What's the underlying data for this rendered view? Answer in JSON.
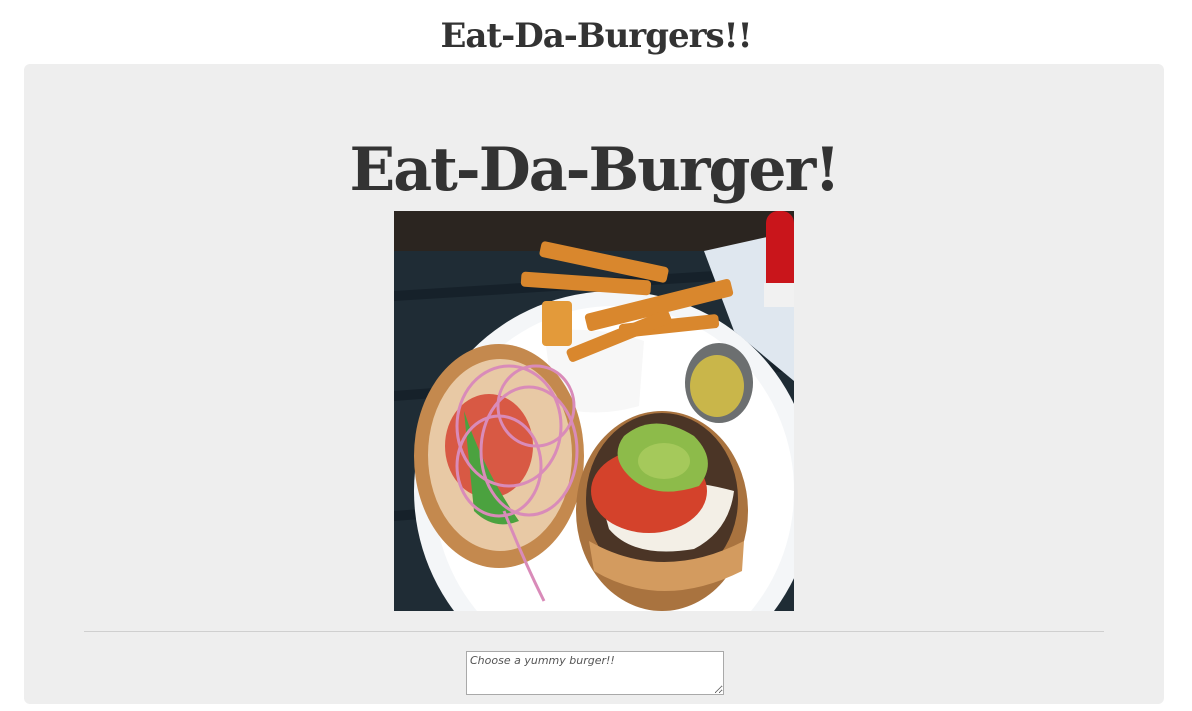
{
  "header": {
    "site_title": "Eat-Da-Burgers!!"
  },
  "main": {
    "hero_title": "Eat-Da-Burger!",
    "image_icon": "burger-plate-photo"
  },
  "form": {
    "burger_placeholder": "Choose a yummy burger!!",
    "burger_value": ""
  },
  "colors": {
    "jumbotron_background": "#eeeeee",
    "title_text": "#333333",
    "divider": "#cfcfcf"
  }
}
